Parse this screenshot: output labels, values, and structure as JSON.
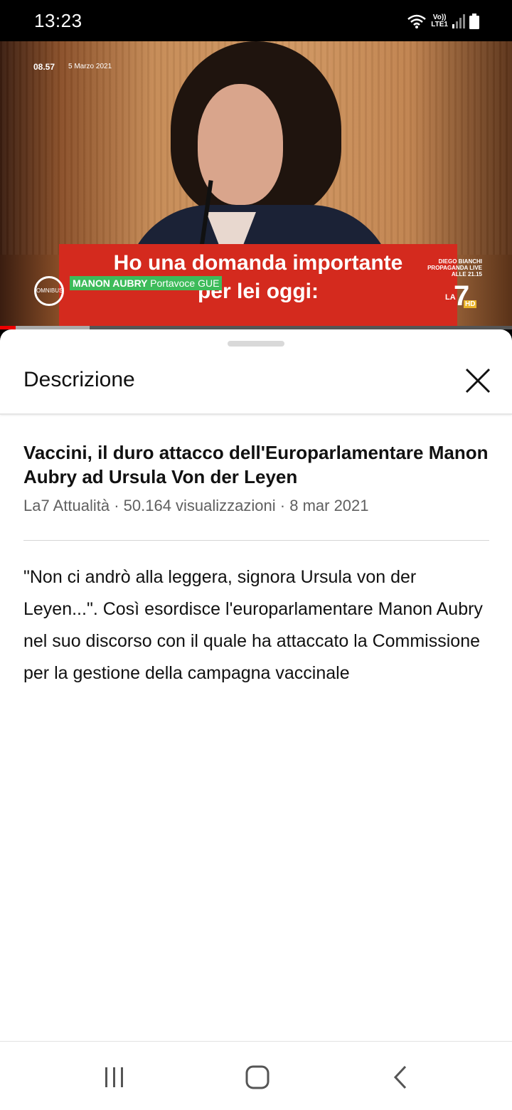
{
  "status_bar": {
    "time": "13:23",
    "network_line1": "Vo))",
    "network_line2": "LTE1"
  },
  "video": {
    "overlay_time": "08.57",
    "overlay_date": "5 Marzo 2021",
    "caption_line1": "Ho una domanda importante",
    "caption_line2": "per lei oggi:",
    "speaker_name": "MANON AUBRY",
    "speaker_role": "Portavoce GUE",
    "show_logo": "OMNIBUS",
    "promo_line1": "DIEGO BIANCHI",
    "promo_line2": "PROPAGANDA LIVE",
    "promo_line3": "ALLE 21.15",
    "channel_logo_la": "LA",
    "channel_logo_seven": "7",
    "channel_logo_hd": "HD",
    "progress_played": 0.03,
    "progress_buffered": 0.175
  },
  "sheet": {
    "title": "Descrizione",
    "close_icon": "close-icon"
  },
  "details": {
    "title": "Vaccini, il duro attacco dell'Europarlamentare Manon Aubry ad Ursula Von der Leyen",
    "meta": "La7 Attualità · 50.164 visualizzazioni · 8 mar 2021",
    "description": "\"Non ci andrò alla leggera, signora Ursula von der Leyen...\". Così esordisce l'europarlamentare Manon Aubry nel suo discorso con il  quale ha attaccato la Commissione per la gestione della campagna vaccinale"
  },
  "nav_bar": {
    "recents_icon": "recent-apps-icon",
    "home_icon": "home-icon",
    "back_icon": "back-icon"
  },
  "colors": {
    "accent_red": "#ff0000",
    "caption_red": "#d42a1e",
    "name_tag_green": "#3dbb5a"
  }
}
